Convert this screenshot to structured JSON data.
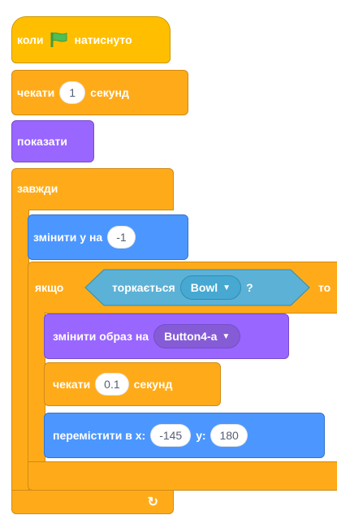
{
  "blocks": {
    "when_flag": {
      "prefix": "коли",
      "suffix": "натиснуто",
      "flag_icon": "green-flag-icon"
    },
    "wait1": {
      "prefix": "чекати",
      "value": "1",
      "suffix": "секунд"
    },
    "show": {
      "label": "показати"
    },
    "forever": {
      "label": "завжди"
    },
    "change_y": {
      "label": "змінити у на",
      "value": "-1"
    },
    "if": {
      "label": "якщо",
      "then_label": "то"
    },
    "touching": {
      "label": "торкається",
      "value": "Bowl",
      "question": "?"
    },
    "switch_costume": {
      "label": "змінити образ на",
      "value": "Button4-a"
    },
    "wait2": {
      "prefix": "чекати",
      "value": "0.1",
      "suffix": "секунд"
    },
    "goto": {
      "label": "перемістити в x:",
      "x_value": "-145",
      "y_label": "у:",
      "y_value": "180"
    }
  },
  "colors": {
    "events": "#ffbf00",
    "control": "#ffab19",
    "looks": "#9966ff",
    "motion": "#4c97ff",
    "sensing": "#5cb1d6"
  }
}
